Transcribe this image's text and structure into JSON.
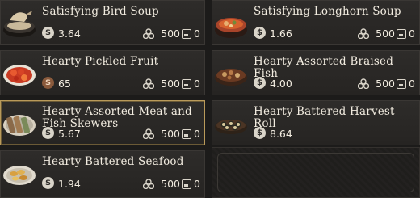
{
  "items": [
    {
      "name": "Satisfying Bird Soup",
      "price": "3.64",
      "currency": "silver",
      "stock": "500",
      "owned": "0"
    },
    {
      "name": "Satisfying Longhorn Soup",
      "price": "1.66",
      "currency": "silver",
      "stock": "500",
      "owned": "0"
    },
    {
      "name": "Hearty Pickled Fruit",
      "price": "65",
      "currency": "bronze",
      "stock": "500",
      "owned": "0"
    },
    {
      "name": "Hearty Assorted Braised Fish",
      "price": "4.00",
      "currency": "silver",
      "stock": "500",
      "owned": "0"
    },
    {
      "name": "Hearty Assorted Meat and Fish Skewers",
      "price": "5.67",
      "currency": "silver",
      "stock": "500",
      "owned": "0"
    },
    {
      "name": "Hearty Battered Harvest Roll",
      "price": "8.64",
      "currency": "silver",
      "stock": "",
      "owned": ""
    },
    {
      "name": "Hearty Battered Seafood",
      "price": "1.94",
      "currency": "silver",
      "stock": "500",
      "owned": "0"
    }
  ],
  "icons": {
    "currency": "coin-icon",
    "stock": "stock-icon",
    "owned": "inventory-box-icon"
  },
  "colors": {
    "selected_border": "#b99a5a",
    "text": "#f1ebdf",
    "card_bg": "#2b2927"
  }
}
